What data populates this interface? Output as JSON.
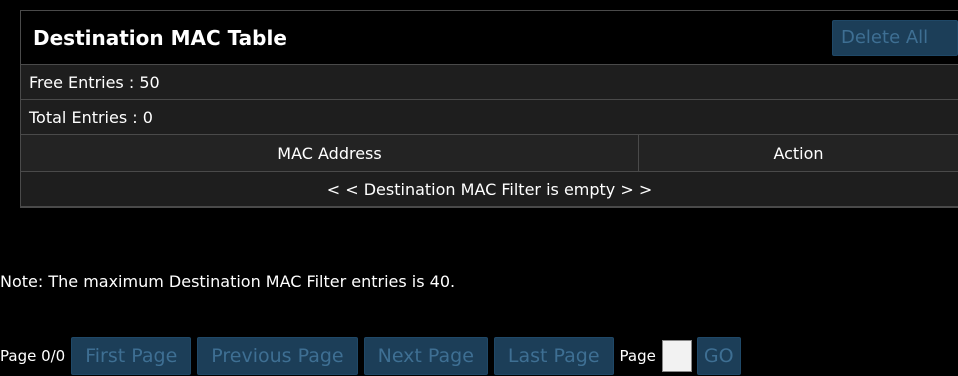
{
  "table": {
    "title": "Destination MAC Table",
    "delete_all_label": "Delete All",
    "free_entries": "Free Entries : 50",
    "total_entries": "Total Entries : 0",
    "columns": [
      "MAC Address",
      "Action"
    ],
    "empty_message": "< < Destination MAC Filter is empty > >"
  },
  "note": "Note: The maximum Destination MAC Filter entries is 40.",
  "pager": {
    "page_status": "Page 0/0",
    "first_label": "First Page",
    "previous_label": "Previous Page",
    "next_label": "Next Page",
    "last_label": "Last Page",
    "page_label": "Page",
    "page_value": "",
    "go_label": "GO"
  },
  "colors": {
    "background": "#000000",
    "button_bg": "#1c3e58",
    "button_text": "#3e6f93"
  }
}
